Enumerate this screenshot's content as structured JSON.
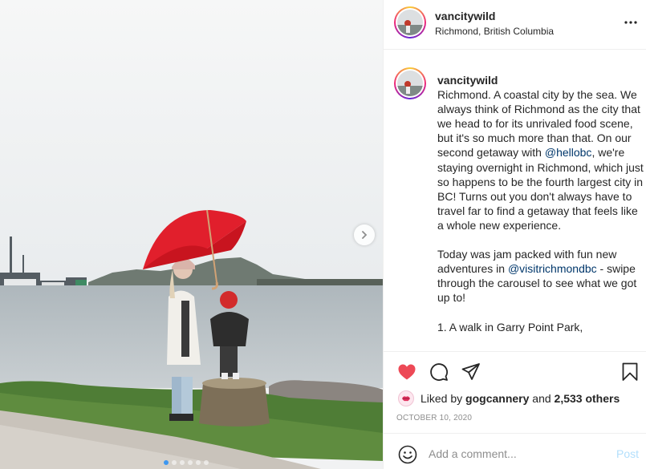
{
  "post": {
    "image_alt": "",
    "carousel": {
      "slides": 6,
      "active": 0
    },
    "user": {
      "username": "vancitywild",
      "location": "Richmond, British Columbia"
    },
    "caption": {
      "username": "vancitywild",
      "parts": [
        {
          "t": "Richmond. A coastal city by the sea. We always think of Richmond as the city that we head to for its unrivaled food scene, but it's so much more than that. On our second getaway with "
        },
        {
          "t": "@hellobc",
          "mention": true
        },
        {
          "t": ", we're staying overnight in Richmond, which just so happens to be the fourth largest city in BC! Turns out you don't always have to travel far to find a getaway that feels like a whole new experience.\n\nToday was jam packed with fun new adventures in "
        },
        {
          "t": "@visitrichmondbc",
          "mention": true
        },
        {
          "t": " - swipe through the carousel to see what we got up to!\n\n1. A walk in Garry Point Park,"
        }
      ]
    },
    "likes": {
      "prefix": "Liked by",
      "user": "gogcannery",
      "and": "and",
      "others": "2,533 others"
    },
    "date": "OCTOBER 10, 2020",
    "comment": {
      "placeholder": "Add a comment...",
      "post_label": "Post"
    },
    "icons": {
      "more": "more-horizontal-icon",
      "like": "heart-filled-icon",
      "comment": "comment-bubble-icon",
      "share": "paper-plane-icon",
      "save": "bookmark-icon",
      "emoji": "smiley-icon",
      "next": "chevron-right-icon"
    },
    "colors": {
      "like": "#ed4956",
      "mention": "#00376b",
      "post_disabled": "#b2dffc",
      "muted": "#8e8e8e",
      "carousel_dot_active": "#3d97f0"
    }
  }
}
